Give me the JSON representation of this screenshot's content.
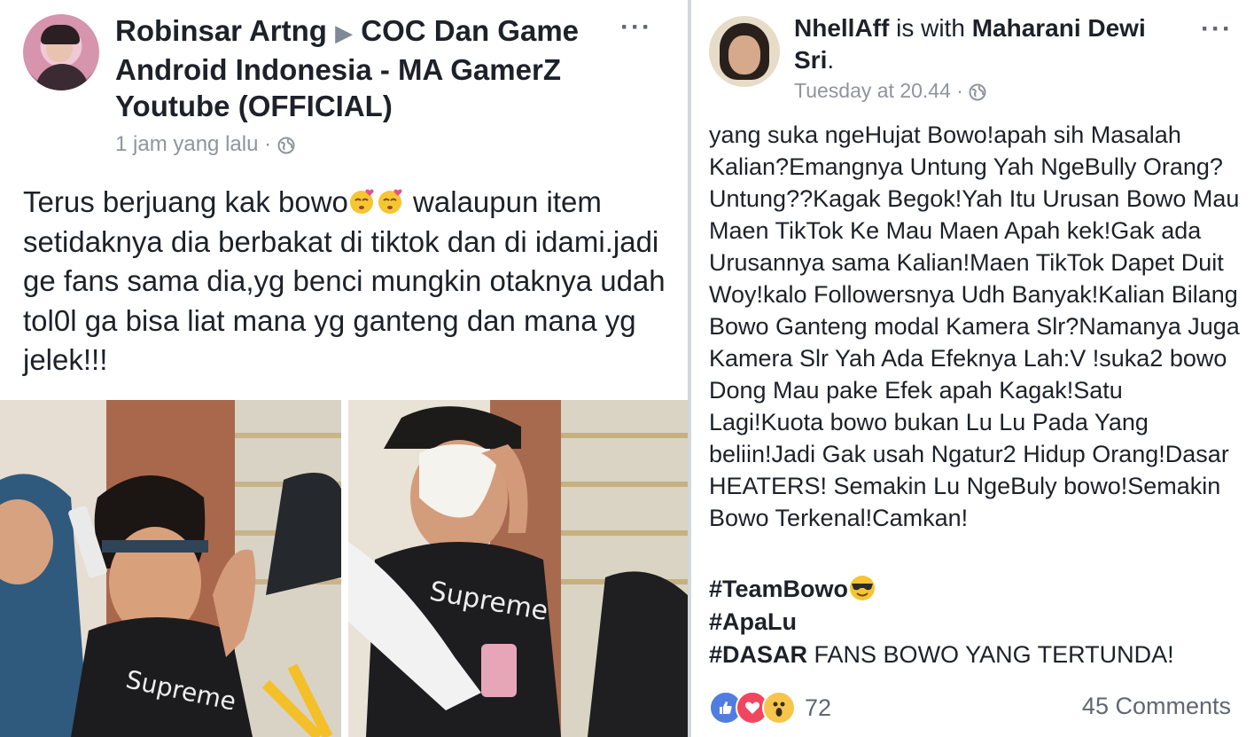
{
  "left_post": {
    "author": "Robinsar Artng",
    "arrow": "▶",
    "group": "COC Dan Game Android Indonesia - MA GamerZ Youtube (OFFICIAL)",
    "time": "1 jam yang lalu",
    "separator": "·",
    "more": "···",
    "body_part1": "Terus berjuang kak bowo",
    "body_part2": " walaupun item setidaknya dia berbakat di tiktok dan di idami.jadi ge fans sama dia,yg benci mungkin otaknya udah tol0l ga bisa liat mana yg ganteng dan mana yg jelek!!!",
    "emoji": "kissing-face-hearts-icon"
  },
  "right_post": {
    "author": "NhellAff",
    "with_text": " is with ",
    "tagged": "Maharani Dewi Sri",
    "period": ".",
    "time": "Tuesday at 20.44",
    "separator": "·",
    "more": "···",
    "body": "yang suka ngeHujat Bowo!apah sih Masalah Kalian?Emangnya Untung Yah NgeBully Orang?Untung??Kagak Begok!Yah Itu Urusan Bowo Mau Maen TikTok Ke Mau Maen Apah kek!Gak ada Urusannya sama Kalian!Maen TikTok Dapet Duit Woy!kalo Followersnya Udh Banyak!Kalian Bilang Bowo Ganteng modal Kamera Slr?Namanya Juga Kamera Slr Yah Ada Efeknya Lah:V !suka2 bowo Dong Mau pake Efek apah Kagak!Satu Lagi!Kuota bowo bukan Lu Lu Pada Yang beliin!Jadi Gak usah Ngatur2 Hidup Orang!Dasar HEATERS! Semakin Lu NgeBuly bowo!Semakin Bowo Terkenal!Camkan!",
    "hashtag1": "#TeamBowo",
    "hashtag2": "#ApaLu",
    "hashtag3": "#DASAR",
    "hashtag3_rest": " FANS BOWO YANG TERTUNDA!",
    "reaction_count": "72",
    "comments": "45 Comments"
  },
  "colors": {
    "text": "#1d2129",
    "meta": "#90949c",
    "like": "#4f7de0",
    "love": "#f0465f",
    "wow": "#f6c64c",
    "divider": "#d3d6db"
  }
}
